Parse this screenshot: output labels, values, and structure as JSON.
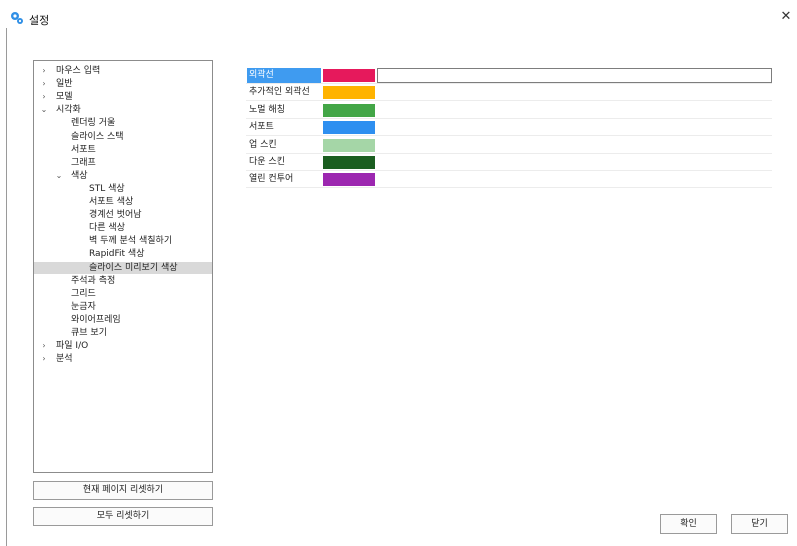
{
  "window": {
    "title": "설정",
    "close_symbol": "✕"
  },
  "tree": {
    "items": [
      {
        "label": "마우스 입력",
        "expander": "›"
      },
      {
        "label": "일반",
        "expander": "›"
      },
      {
        "label": "모델",
        "expander": "›"
      },
      {
        "label": "시각화",
        "expander": "⌄"
      },
      {
        "label": "렌더링 거울",
        "expander": ""
      },
      {
        "label": "슬라이스 스택",
        "expander": ""
      },
      {
        "label": "서포트",
        "expander": ""
      },
      {
        "label": "그래프",
        "expander": ""
      },
      {
        "label": "색상",
        "expander": "⌄"
      },
      {
        "label": "STL 색상",
        "expander": ""
      },
      {
        "label": "서포트 색상",
        "expander": ""
      },
      {
        "label": "경계선 벗어남",
        "expander": ""
      },
      {
        "label": "다른 색상",
        "expander": ""
      },
      {
        "label": "벽 두께 분석 색칠하기",
        "expander": ""
      },
      {
        "label": "RapidFit 색상",
        "expander": ""
      },
      {
        "label": "슬라이스 미리보기 색상",
        "expander": ""
      },
      {
        "label": "주석과 측정",
        "expander": ""
      },
      {
        "label": "그리드",
        "expander": ""
      },
      {
        "label": "눈금자",
        "expander": ""
      },
      {
        "label": "와이어프레임",
        "expander": ""
      },
      {
        "label": "큐브 보기",
        "expander": ""
      },
      {
        "label": "파일 I/O",
        "expander": "›"
      },
      {
        "label": "분석",
        "expander": "›"
      }
    ],
    "selected_label": "슬라이스 미리보기 색상"
  },
  "buttons": {
    "reset_page": "현재 페이지 리셋하기",
    "reset_all": "모두 리셋하기",
    "ok": "확인",
    "close": "닫기"
  },
  "colors": {
    "rows": [
      {
        "label": "외곽선",
        "color": "#e6195c",
        "active": true
      },
      {
        "label": "추가적인 외곽선",
        "color": "#ffb300",
        "active": false
      },
      {
        "label": "노멀 해칭",
        "color": "#43a647",
        "active": false
      },
      {
        "label": "서포트",
        "color": "#2e8ff0",
        "active": false
      },
      {
        "label": "업 스킨",
        "color": "#a5d6a7",
        "active": false
      },
      {
        "label": "다운 스킨",
        "color": "#1b5e20",
        "active": false
      },
      {
        "label": "열린 컨투어",
        "color": "#9c27b0",
        "active": false
      }
    ]
  }
}
